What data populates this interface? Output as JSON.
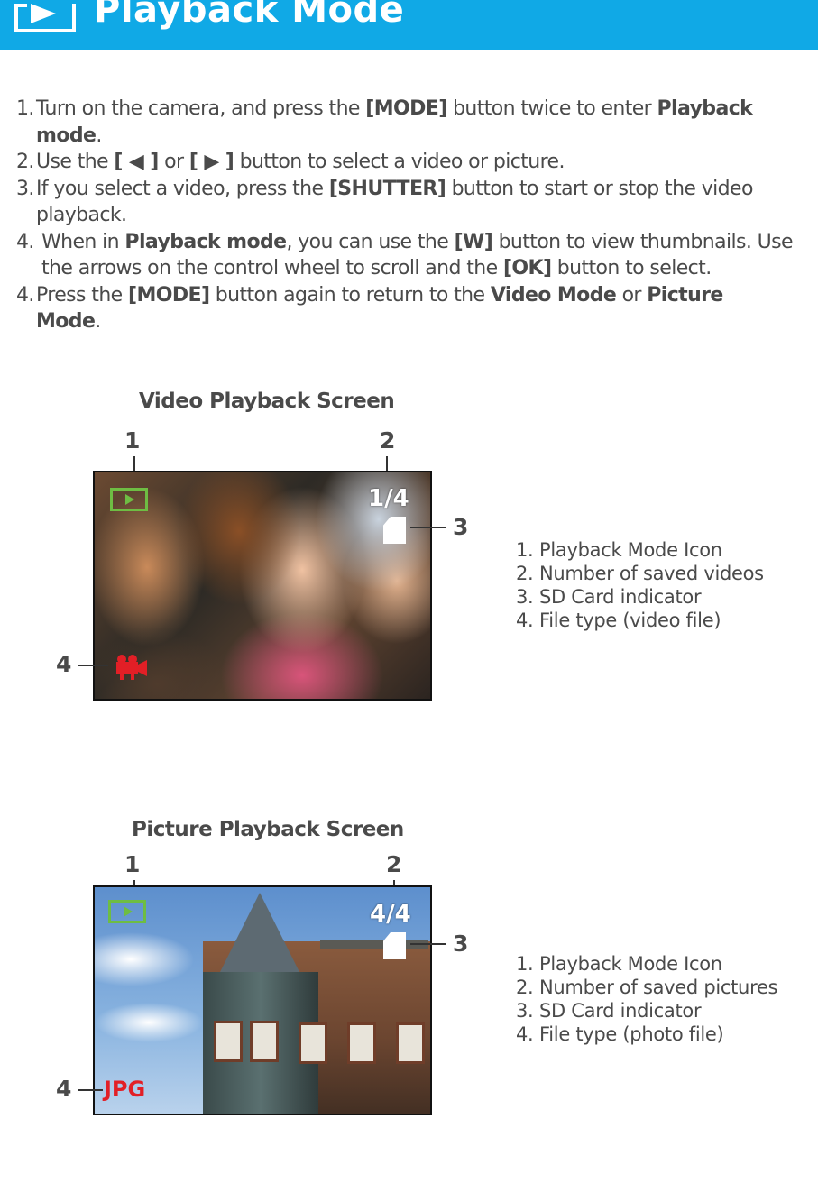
{
  "header": {
    "title": "Playback Mode",
    "icon": "playback-mode-icon",
    "bg_color": "#10a9e6"
  },
  "instructions": [
    {
      "num": "1.",
      "line1": [
        {
          "t": "Turn on the camera, and press the ",
          "b": false
        },
        {
          "t": "[MODE]",
          "b": true
        },
        {
          "t": " button twice to enter ",
          "b": false
        },
        {
          "t": "Playback",
          "b": true
        }
      ],
      "line2": [
        {
          "t": "mode",
          "b": true
        },
        {
          "t": ".",
          "b": false
        }
      ]
    },
    {
      "num": "2.",
      "line1": [
        {
          "t": "Use the ",
          "b": false
        },
        {
          "t": "[ ◀ ]",
          "b": true
        },
        {
          "t": "  or  ",
          "b": false
        },
        {
          "t": "[ ▶ ]",
          "b": true
        },
        {
          "t": " button to select a video or picture.",
          "b": false
        }
      ]
    },
    {
      "num": "3.",
      "line1": [
        {
          "t": "If you select a video, press the ",
          "b": false
        },
        {
          "t": "[SHUTTER]",
          "b": true
        },
        {
          "t": " button to start or stop the video",
          "b": false
        }
      ],
      "line2": [
        {
          "t": "playback.",
          "b": false
        }
      ]
    },
    {
      "num": "4.",
      "line1": [
        {
          "t": "When in ",
          "b": false
        },
        {
          "t": "Playback mode",
          "b": true
        },
        {
          "t": ", you can use the ",
          "b": false
        },
        {
          "t": "[W]",
          "b": true
        },
        {
          "t": " button to view thumbnails.  Use",
          "b": false
        }
      ],
      "line2": [
        {
          "t": " the arrows on the control wheel to scroll and the ",
          "b": false
        },
        {
          "t": "[OK]",
          "b": true
        },
        {
          "t": " button to select.",
          "b": false
        }
      ]
    },
    {
      "num": "4.",
      "line1": [
        {
          "t": "Press the ",
          "b": false
        },
        {
          "t": "[MODE]",
          "b": true
        },
        {
          "t": " button again to return to the ",
          "b": false
        },
        {
          "t": "Video Mode",
          "b": true
        },
        {
          "t": " or ",
          "b": false
        },
        {
          "t": "Picture",
          "b": true
        }
      ],
      "line2": [
        {
          "t": "Mode",
          "b": true
        },
        {
          "t": ".",
          "b": false
        }
      ]
    }
  ],
  "video_screen": {
    "title": "Video Playback Screen",
    "callouts": [
      "1",
      "2",
      "3",
      "4"
    ],
    "counter": "1/4",
    "play_icon": "play-icon",
    "file_type_icon": "video-camera-icon",
    "sd_icon": "sd-card-icon",
    "legend": [
      {
        "n": "1.",
        "t": "Playback Mode Icon"
      },
      {
        "n": "2.",
        "t": "Number of saved videos"
      },
      {
        "n": "3.",
        "t": "SD Card indicator"
      },
      {
        "n": "4.",
        "t": "File type (video file)"
      }
    ]
  },
  "picture_screen": {
    "title": "Picture Playback Screen",
    "callouts": [
      "1",
      "2",
      "3",
      "4"
    ],
    "counter": "4/4",
    "file_type_label": "JPG",
    "play_icon": "play-icon",
    "sd_icon": "sd-card-icon",
    "legend": [
      {
        "n": "1.",
        "t": "Playback Mode Icon"
      },
      {
        "n": "2.",
        "t": "Number of saved pictures"
      },
      {
        "n": "3.",
        "t": "SD Card indicator"
      },
      {
        "n": "4.",
        "t": "File type (photo file)"
      }
    ]
  },
  "colors": {
    "accent_blue": "#10a9e6",
    "icon_green": "#6ebd43",
    "file_type_red": "#e21f26",
    "body_text": "#4a4a4a"
  }
}
